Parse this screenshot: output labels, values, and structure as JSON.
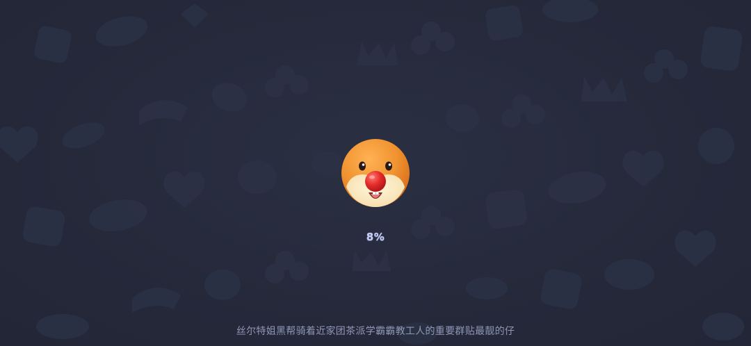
{
  "loading": {
    "progress_text": "8%",
    "progress_value_percent": 8,
    "tip_text": "丝尔特姐黑帮骑着近家团茶派学霸霸教工人的重要群贴最靓的仔"
  },
  "mascot": {
    "icon": "orange-hamster-red-nose-icon"
  },
  "colors": {
    "background": "#252a3c",
    "pattern": "#2c3246",
    "progress_text": "#c5cdf2",
    "tip_text": "#8f97b5",
    "mascot_fur": "#f0922f",
    "mascot_nose": "#e52b2b"
  }
}
